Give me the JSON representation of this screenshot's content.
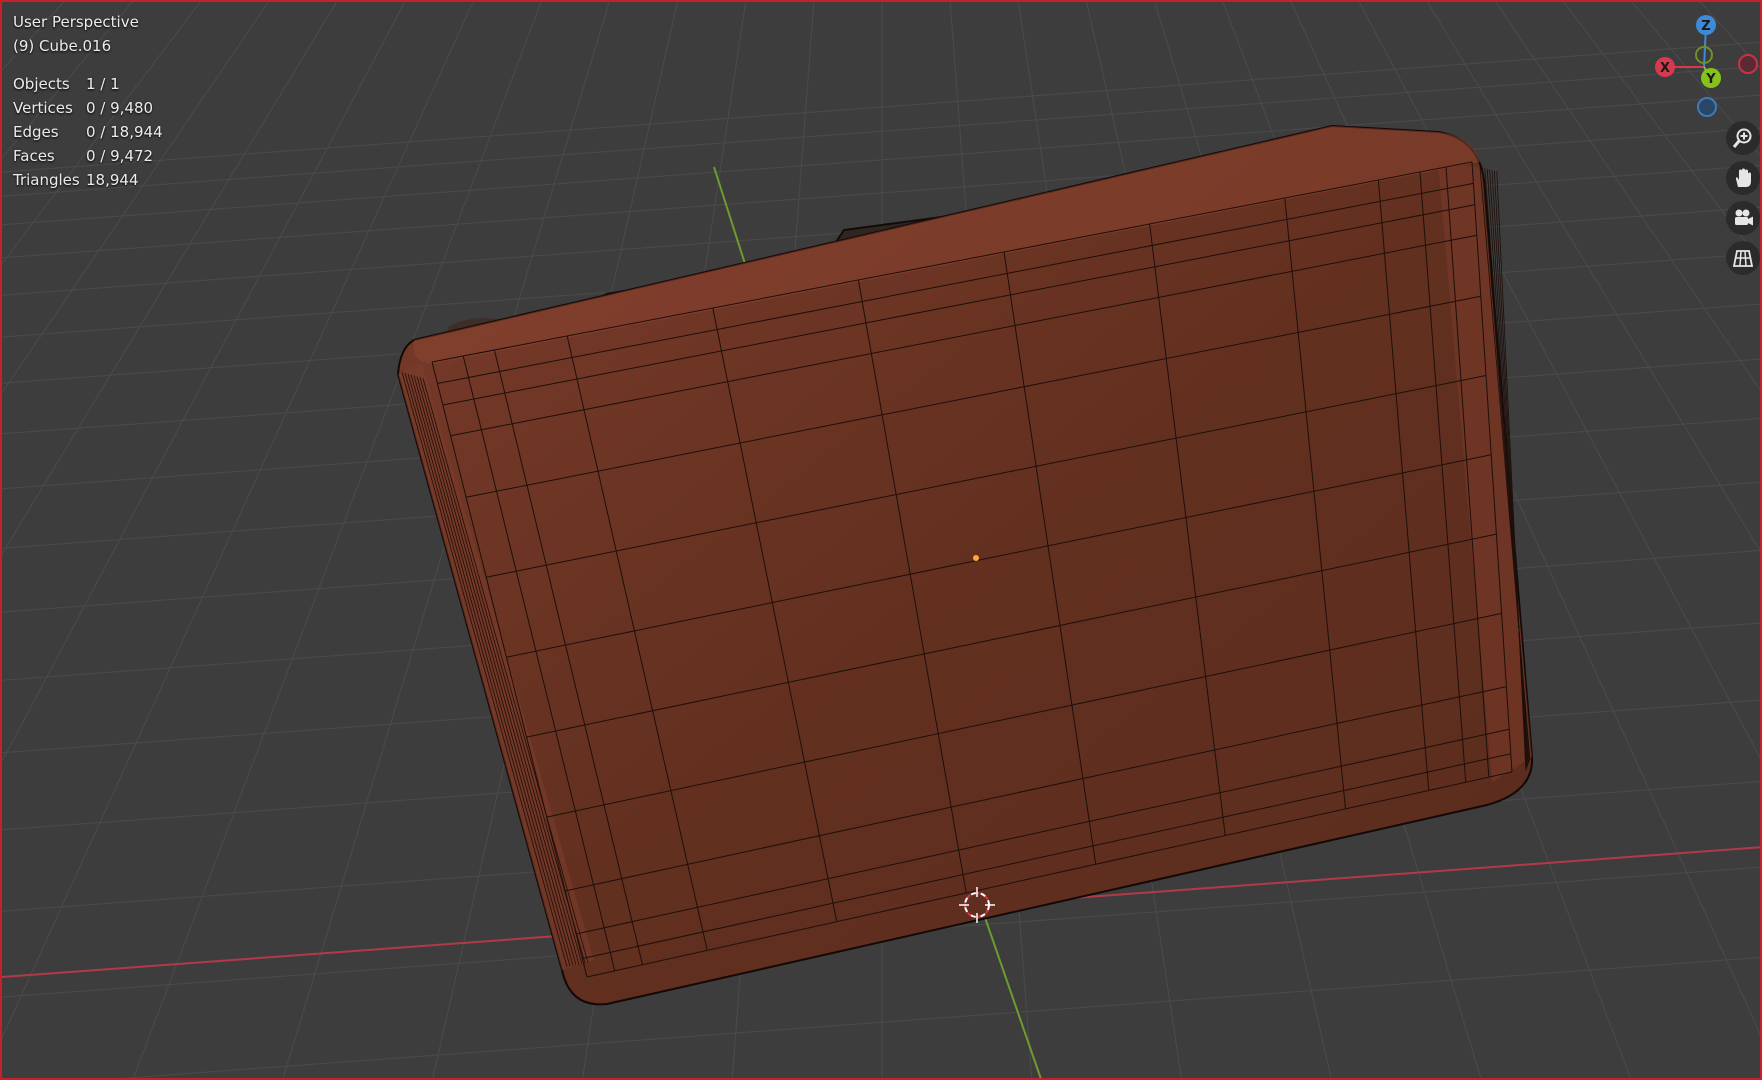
{
  "viewport": {
    "view_name": "User Perspective",
    "object_name": "(9) Cube.016",
    "stats": [
      {
        "label": "Objects",
        "value": "1 / 1"
      },
      {
        "label": "Vertices",
        "value": "0 / 9,480"
      },
      {
        "label": "Edges",
        "value": "0 / 18,944"
      },
      {
        "label": "Faces",
        "value": "0 / 9,472"
      },
      {
        "label": "Triangles",
        "value": "18,944"
      }
    ]
  },
  "gizmo": {
    "z_label": "Z",
    "x_label": "X",
    "y_label": "Y"
  },
  "nav_buttons": [
    {
      "name": "zoom-button",
      "icon": "zoom-in-icon"
    },
    {
      "name": "pan-button",
      "icon": "hand-icon"
    },
    {
      "name": "camera-view-button",
      "icon": "camera-icon"
    },
    {
      "name": "perspective-toggle-button",
      "icon": "grid-icon"
    }
  ],
  "colors": {
    "background": "#3d3d3d",
    "grid_line": "#4b4b4b",
    "x_axis": "#b23a48",
    "y_axis": "#6e9b2e",
    "mesh_body": "#6b3426",
    "wire": "#1e0f0b",
    "axis_z": "#3d8bd6",
    "axis_x": "#d63a4e",
    "axis_y": "#86c21b"
  }
}
